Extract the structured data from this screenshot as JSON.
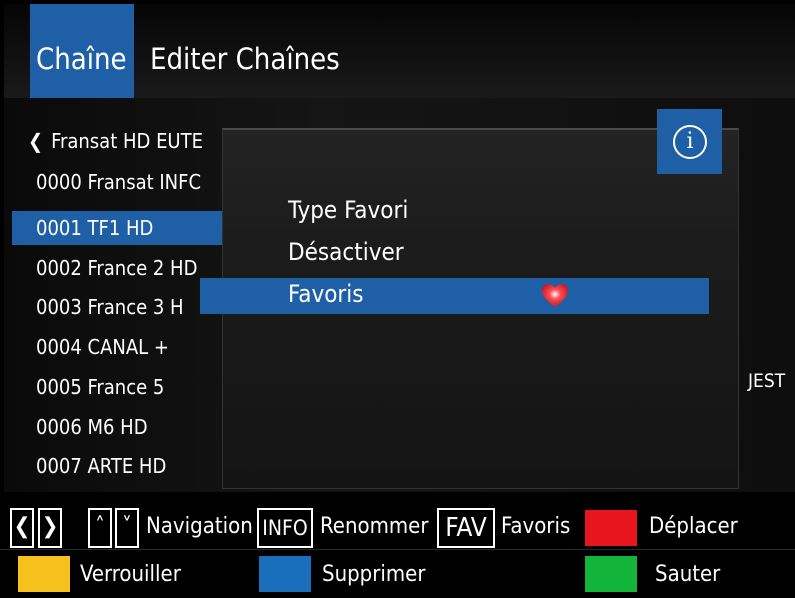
{
  "header": {
    "tab_label": "Chaîne",
    "title": "Editer Chaînes"
  },
  "channel_list": {
    "satellite": "Fransat HD EUTE",
    "rows": [
      "0000 Fransat INFC",
      "0001 TF1 HD",
      "0002 France 2 HD",
      "0003 France 3 H",
      "0004 CANAL +",
      "0005 France 5",
      "0006 M6 HD",
      "0007 ARTE HD"
    ],
    "selected_index": 1
  },
  "side_text": "JEST",
  "popup": {
    "info_icon": "info-icon",
    "items": [
      "Type Favori",
      "Désactiver",
      "Favoris"
    ],
    "selected_item": "Favoris",
    "heart_color": "#e81e2a"
  },
  "footer": {
    "nav_label": "Navigation",
    "info_key": "INFO",
    "info_label": "Renommer",
    "fav_key": "FAV",
    "fav_label": "Favoris",
    "red_label": "Déplacer",
    "yellow_label": "Verrouiller",
    "blue_label": "Supprimer",
    "green_label": "Sauter",
    "colors": {
      "red": "#e8141e",
      "yellow": "#f7c21c",
      "blue": "#1a6fbd",
      "green": "#12b43a"
    }
  }
}
